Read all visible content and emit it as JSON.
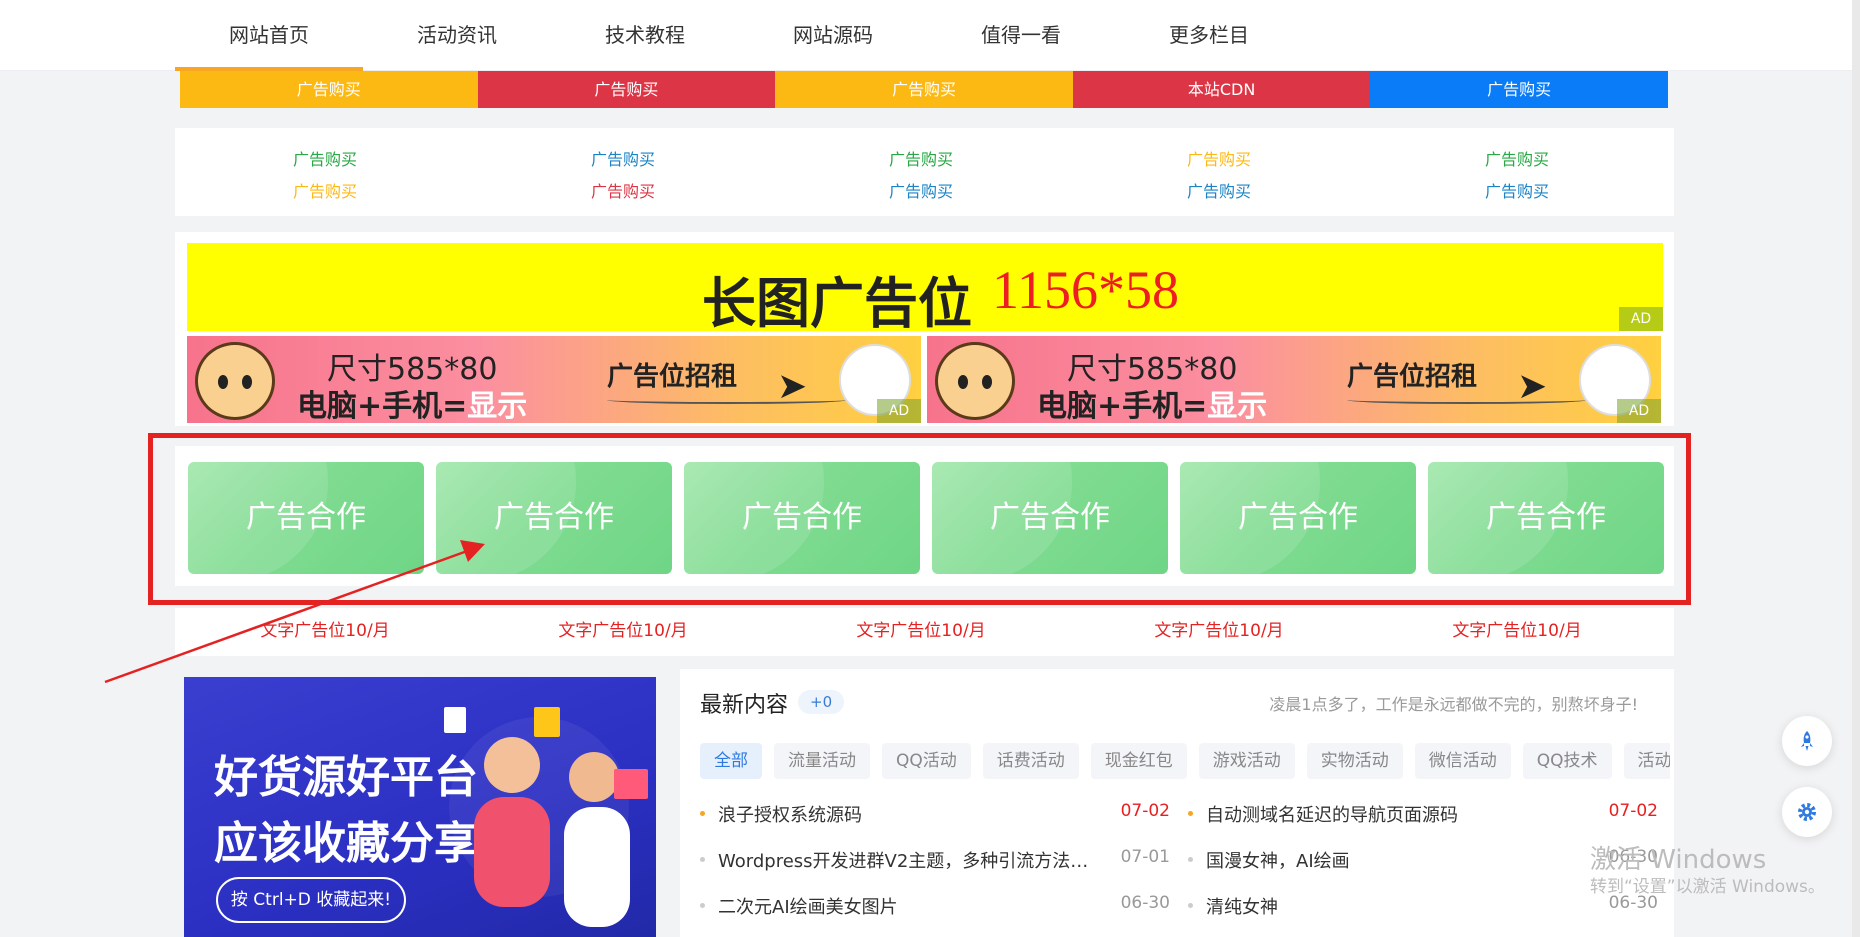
{
  "nav": {
    "items": [
      "网站首页",
      "活动资讯",
      "技术教程",
      "网站源码",
      "值得一看",
      "更多栏目"
    ],
    "accent": "#f6a623"
  },
  "colorbar": [
    {
      "label": "广告购买",
      "color": "#fdb913"
    },
    {
      "label": "广告购买",
      "color": "#dc3545"
    },
    {
      "label": "广告购买",
      "color": "#fdb913"
    },
    {
      "label": "本站CDN",
      "color": "#dc3545"
    },
    {
      "label": "广告购买",
      "color": "#0a7cf8"
    }
  ],
  "text_links": [
    [
      {
        "label": "广告购买",
        "color": "#28a745"
      },
      {
        "label": "广告购买",
        "color": "#fdb913"
      }
    ],
    [
      {
        "label": "广告购买",
        "color": "#1c84c6"
      },
      {
        "label": "广告购买",
        "color": "#dc3545"
      }
    ],
    [
      {
        "label": "广告购买",
        "color": "#28a745"
      },
      {
        "label": "广告购买",
        "color": "#1c84c6"
      }
    ],
    [
      {
        "label": "广告购买",
        "color": "#fdb913"
      },
      {
        "label": "广告购买",
        "color": "#1c84c6"
      }
    ],
    [
      {
        "label": "广告购买",
        "color": "#28a745"
      },
      {
        "label": "广告购买",
        "color": "#1c84c6"
      }
    ]
  ],
  "long_ad": {
    "text": "长图广告位",
    "size": "1156*58",
    "tag": "AD"
  },
  "half_ads": [
    {
      "size_text": "尺寸585*80",
      "line2_a": "电脑+手机=",
      "line2_b": "显示",
      "rent": "广告位招租",
      "tag": "AD"
    },
    {
      "size_text": "尺寸585*80",
      "line2_a": "电脑+手机=",
      "line2_b": "显示",
      "rent": "广告位招租",
      "tag": "AD"
    }
  ],
  "coop_cards": [
    "广告合作",
    "广告合作",
    "广告合作",
    "广告合作",
    "广告合作",
    "广告合作"
  ],
  "text_ads": [
    "文字广告位10/月",
    "文字广告位10/月",
    "文字广告位10/月",
    "文字广告位10/月",
    "文字广告位10/月"
  ],
  "promo": {
    "line1": "好货源好平台",
    "line2": "应该收藏分享",
    "button": "按 Ctrl+D 收藏起来!"
  },
  "latest": {
    "title": "最新内容",
    "badge": "+0",
    "slogan": "凌晨1点多了，工作是永远都做不完的，别熬坏身子!",
    "tabs": [
      "全部",
      "流量活动",
      "QQ活动",
      "话费活动",
      "现金红包",
      "游戏活动",
      "实物活动",
      "微信活动",
      "QQ技术",
      "活动"
    ],
    "items": [
      {
        "title": "浪子授权系统源码",
        "date": "07-02",
        "hot": true
      },
      {
        "title": "自动测域名延迟的导航页面源码",
        "date": "07-02",
        "hot": true
      },
      {
        "title": "Wordpress开发进群V2主题，多种引流方法，私...",
        "date": "07-01",
        "hot": false
      },
      {
        "title": "国漫女神，AI绘画",
        "date": "06-30",
        "hot": false
      },
      {
        "title": "二次元AI绘画美女图片",
        "date": "06-30",
        "hot": false
      },
      {
        "title": "清纯女神",
        "date": "06-30",
        "hot": false
      }
    ]
  },
  "watermark": {
    "line1": "激活 Windows",
    "line2": "转到“设置”以激活 Windows。"
  }
}
